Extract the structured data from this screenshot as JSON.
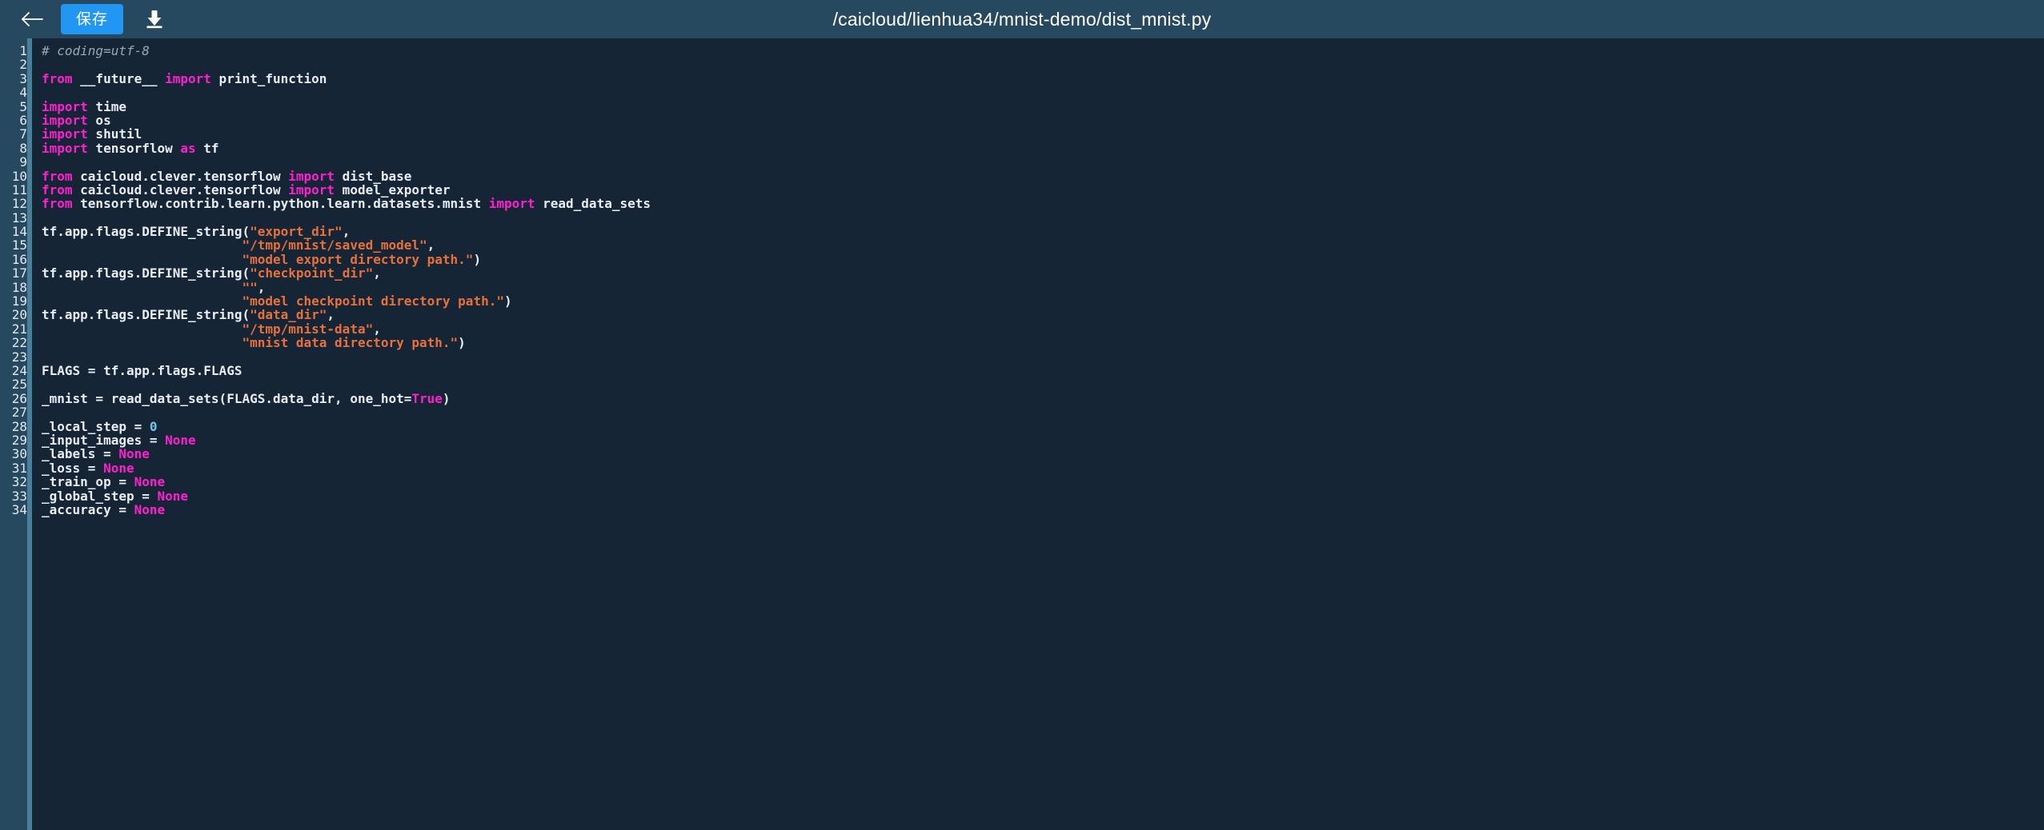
{
  "toolbar": {
    "back_icon": "arrow-left-icon",
    "save_label": "保存",
    "download_icon": "download-icon",
    "title": "/caicloud/lienhua34/mnist-demo/dist_mnist.py"
  },
  "colors": {
    "header_bg": "#26495F",
    "editor_bg": "#152536",
    "gutter_bg": "#26495F",
    "gutter_divider": "#4A7F9B",
    "accent_button": "#2196F3",
    "keyword": "#FF1FD0",
    "string": "#E8713A",
    "number": "#6FC3E8",
    "comment": "#9BA7B0",
    "text": "#E8EDF2"
  },
  "editor": {
    "language": "python",
    "first_line_number": 1,
    "last_visible_line_number": 34,
    "lines": [
      {
        "n": 1,
        "tokens": [
          {
            "t": "com",
            "v": "# coding=utf-8"
          }
        ]
      },
      {
        "n": 2,
        "tokens": []
      },
      {
        "n": 3,
        "tokens": [
          {
            "t": "kw",
            "v": "from"
          },
          {
            "t": "plain",
            "v": " __future__ "
          },
          {
            "t": "kw",
            "v": "import"
          },
          {
            "t": "plain",
            "v": " print_function"
          }
        ]
      },
      {
        "n": 4,
        "tokens": []
      },
      {
        "n": 5,
        "tokens": [
          {
            "t": "kw",
            "v": "import"
          },
          {
            "t": "plain",
            "v": " time"
          }
        ]
      },
      {
        "n": 6,
        "tokens": [
          {
            "t": "kw",
            "v": "import"
          },
          {
            "t": "plain",
            "v": " os"
          }
        ]
      },
      {
        "n": 7,
        "tokens": [
          {
            "t": "kw",
            "v": "import"
          },
          {
            "t": "plain",
            "v": " shutil"
          }
        ]
      },
      {
        "n": 8,
        "tokens": [
          {
            "t": "kw",
            "v": "import"
          },
          {
            "t": "plain",
            "v": " tensorflow "
          },
          {
            "t": "kw",
            "v": "as"
          },
          {
            "t": "plain",
            "v": " tf"
          }
        ]
      },
      {
        "n": 9,
        "tokens": []
      },
      {
        "n": 10,
        "tokens": [
          {
            "t": "kw",
            "v": "from"
          },
          {
            "t": "plain",
            "v": " caicloud.clever.tensorflow "
          },
          {
            "t": "kw",
            "v": "import"
          },
          {
            "t": "plain",
            "v": " dist_base"
          }
        ]
      },
      {
        "n": 11,
        "tokens": [
          {
            "t": "kw",
            "v": "from"
          },
          {
            "t": "plain",
            "v": " caicloud.clever.tensorflow "
          },
          {
            "t": "kw",
            "v": "import"
          },
          {
            "t": "plain",
            "v": " model_exporter"
          }
        ]
      },
      {
        "n": 12,
        "tokens": [
          {
            "t": "kw",
            "v": "from"
          },
          {
            "t": "plain",
            "v": " tensorflow.contrib.learn.python.learn.datasets.mnist "
          },
          {
            "t": "kw",
            "v": "import"
          },
          {
            "t": "plain",
            "v": " read_data_sets"
          }
        ]
      },
      {
        "n": 13,
        "tokens": []
      },
      {
        "n": 14,
        "tokens": [
          {
            "t": "plain",
            "v": "tf.app.flags.DEFINE_string("
          },
          {
            "t": "str",
            "v": "\"export_dir\""
          },
          {
            "t": "plain",
            "v": ","
          }
        ]
      },
      {
        "n": 15,
        "tokens": [
          {
            "t": "plain",
            "v": "                          "
          },
          {
            "t": "str",
            "v": "\"/tmp/mnist/saved_model\""
          },
          {
            "t": "plain",
            "v": ","
          }
        ]
      },
      {
        "n": 16,
        "tokens": [
          {
            "t": "plain",
            "v": "                          "
          },
          {
            "t": "str",
            "v": "\"model export directory path.\""
          },
          {
            "t": "plain",
            "v": ")"
          }
        ]
      },
      {
        "n": 17,
        "tokens": [
          {
            "t": "plain",
            "v": "tf.app.flags.DEFINE_string("
          },
          {
            "t": "str",
            "v": "\"checkpoint_dir\""
          },
          {
            "t": "plain",
            "v": ","
          }
        ]
      },
      {
        "n": 18,
        "tokens": [
          {
            "t": "plain",
            "v": "                          "
          },
          {
            "t": "str",
            "v": "\"\""
          },
          {
            "t": "plain",
            "v": ","
          }
        ]
      },
      {
        "n": 19,
        "tokens": [
          {
            "t": "plain",
            "v": "                          "
          },
          {
            "t": "str",
            "v": "\"model checkpoint directory path.\""
          },
          {
            "t": "plain",
            "v": ")"
          }
        ]
      },
      {
        "n": 20,
        "tokens": [
          {
            "t": "plain",
            "v": "tf.app.flags.DEFINE_string("
          },
          {
            "t": "str",
            "v": "\"data_dir\""
          },
          {
            "t": "plain",
            "v": ","
          }
        ]
      },
      {
        "n": 21,
        "tokens": [
          {
            "t": "plain",
            "v": "                          "
          },
          {
            "t": "str",
            "v": "\"/tmp/mnist-data\""
          },
          {
            "t": "plain",
            "v": ","
          }
        ]
      },
      {
        "n": 22,
        "tokens": [
          {
            "t": "plain",
            "v": "                          "
          },
          {
            "t": "str",
            "v": "\"mnist data directory path.\""
          },
          {
            "t": "plain",
            "v": ")"
          }
        ]
      },
      {
        "n": 23,
        "tokens": []
      },
      {
        "n": 24,
        "tokens": [
          {
            "t": "plain",
            "v": "FLAGS = tf.app.flags.FLAGS"
          }
        ]
      },
      {
        "n": 25,
        "tokens": []
      },
      {
        "n": 26,
        "tokens": [
          {
            "t": "plain",
            "v": "_mnist = read_data_sets(FLAGS.data_dir, one_hot="
          },
          {
            "t": "kw",
            "v": "True"
          },
          {
            "t": "plain",
            "v": ")"
          }
        ]
      },
      {
        "n": 27,
        "tokens": []
      },
      {
        "n": 28,
        "tokens": [
          {
            "t": "plain",
            "v": "_local_step = "
          },
          {
            "t": "num",
            "v": "0"
          }
        ]
      },
      {
        "n": 29,
        "tokens": [
          {
            "t": "plain",
            "v": "_input_images = "
          },
          {
            "t": "kw",
            "v": "None"
          }
        ]
      },
      {
        "n": 30,
        "tokens": [
          {
            "t": "plain",
            "v": "_labels = "
          },
          {
            "t": "kw",
            "v": "None"
          }
        ]
      },
      {
        "n": 31,
        "tokens": [
          {
            "t": "plain",
            "v": "_loss = "
          },
          {
            "t": "kw",
            "v": "None"
          }
        ]
      },
      {
        "n": 32,
        "tokens": [
          {
            "t": "plain",
            "v": "_train_op = "
          },
          {
            "t": "kw",
            "v": "None"
          }
        ]
      },
      {
        "n": 33,
        "tokens": [
          {
            "t": "plain",
            "v": "_global_step = "
          },
          {
            "t": "kw",
            "v": "None"
          }
        ]
      },
      {
        "n": 34,
        "tokens": [
          {
            "t": "plain",
            "v": "_accuracy = "
          },
          {
            "t": "kw",
            "v": "None"
          }
        ]
      }
    ]
  }
}
